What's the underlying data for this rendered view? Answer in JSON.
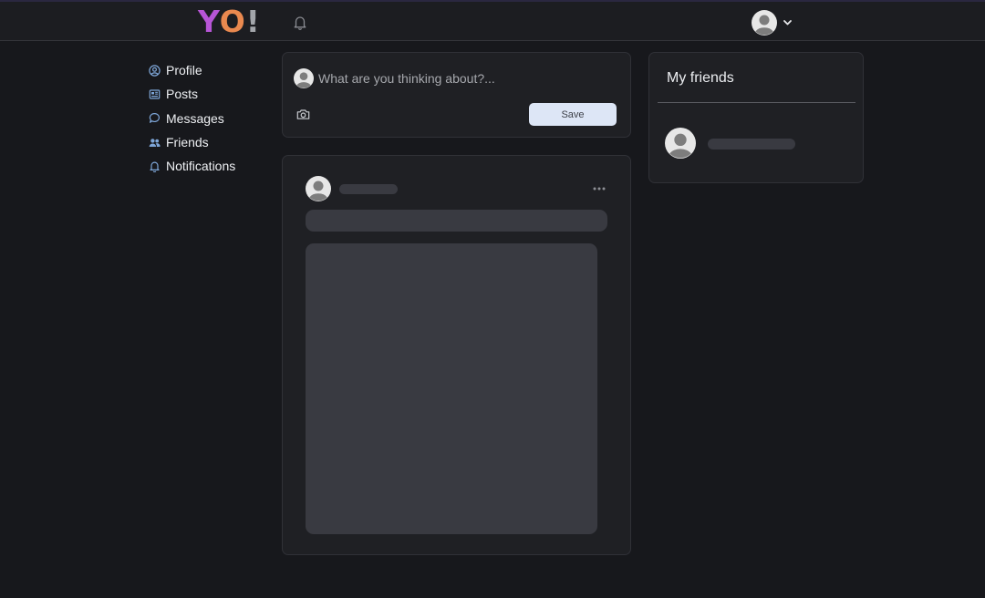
{
  "header": {
    "logo": {
      "y": "Y",
      "o": "O",
      "exclaim": "!"
    },
    "icons": [
      "bell-icon",
      "user-avatar",
      "chevron-down-icon"
    ]
  },
  "sidebar": {
    "items": [
      {
        "label": "Profile",
        "icon": "user-circle-icon"
      },
      {
        "label": "Posts",
        "icon": "newspaper-icon"
      },
      {
        "label": "Messages",
        "icon": "chat-bubble-icon"
      },
      {
        "label": "Friends",
        "icon": "users-icon"
      },
      {
        "label": "Notifications",
        "icon": "bell-icon"
      }
    ]
  },
  "composer": {
    "placeholder": "What are you thinking about?...",
    "value": "",
    "save_label": "Save"
  },
  "friends_panel": {
    "title": "My friends"
  },
  "colors": {
    "background": "#17181c",
    "card": "#1f2024",
    "skeleton": "#393a41",
    "accent_icon": "#7ea6d8",
    "save_button": "#dde6f6",
    "logo_y": "#b755d6",
    "logo_o": "#e9894f"
  }
}
